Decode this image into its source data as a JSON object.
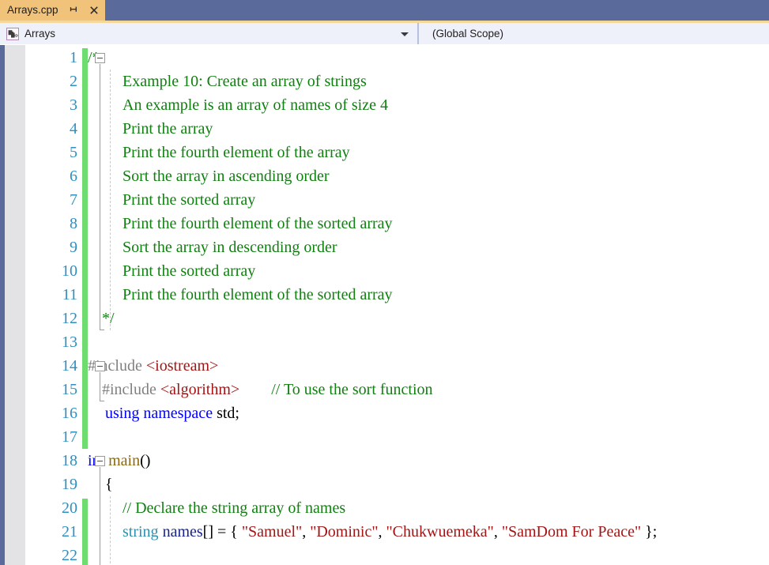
{
  "window": {
    "accent_tab_bg": "#f0c27a",
    "tabstrip_bg": "#5a6a9a",
    "navbar_bg": "#eef1fa",
    "changebar_color": "#6fdc6f"
  },
  "tab": {
    "title": "Arrays.cpp",
    "pin_icon": "pin-icon",
    "close_icon": "close-icon"
  },
  "navbar": {
    "project_icon": "cpp-project-icon",
    "scope_left": "Arrays",
    "scope_right": "(Global Scope)",
    "dropdown_icon": "chevron-down-icon"
  },
  "editor": {
    "language": "cpp",
    "first_line": 1,
    "last_visible_line": 22,
    "line_numbers": [
      1,
      2,
      3,
      4,
      5,
      6,
      7,
      8,
      9,
      10,
      11,
      12,
      13,
      14,
      15,
      16,
      17,
      18,
      19,
      20,
      21,
      22
    ],
    "lines": [
      {
        "n": 1,
        "indent": 0,
        "tokens": [
          {
            "t": "/*",
            "c": "comment"
          }
        ]
      },
      {
        "n": 2,
        "indent": 44,
        "tokens": [
          {
            "t": "Example 10: Create an array of strings",
            "c": "comment"
          }
        ]
      },
      {
        "n": 3,
        "indent": 44,
        "tokens": [
          {
            "t": "An example is an array of names of size 4",
            "c": "comment"
          }
        ]
      },
      {
        "n": 4,
        "indent": 44,
        "tokens": [
          {
            "t": "Print the array",
            "c": "comment"
          }
        ]
      },
      {
        "n": 5,
        "indent": 44,
        "tokens": [
          {
            "t": "Print the fourth element of the array",
            "c": "comment"
          }
        ]
      },
      {
        "n": 6,
        "indent": 44,
        "tokens": [
          {
            "t": "Sort the array in ascending order",
            "c": "comment"
          }
        ]
      },
      {
        "n": 7,
        "indent": 44,
        "tokens": [
          {
            "t": "Print the sorted array",
            "c": "comment"
          }
        ]
      },
      {
        "n": 8,
        "indent": 44,
        "tokens": [
          {
            "t": "Print the fourth element of the sorted array",
            "c": "comment"
          }
        ]
      },
      {
        "n": 9,
        "indent": 44,
        "tokens": [
          {
            "t": "Sort the array in descending order",
            "c": "comment"
          }
        ]
      },
      {
        "n": 10,
        "indent": 44,
        "tokens": [
          {
            "t": "Print the sorted array",
            "c": "comment"
          }
        ]
      },
      {
        "n": 11,
        "indent": 44,
        "tokens": [
          {
            "t": "Print the fourth element of the sorted array",
            "c": "comment"
          }
        ]
      },
      {
        "n": 12,
        "indent": 18,
        "tokens": [
          {
            "t": "*/",
            "c": "comment"
          }
        ]
      },
      {
        "n": 13,
        "indent": 0,
        "tokens": []
      },
      {
        "n": 14,
        "indent": 0,
        "tokens": [
          {
            "t": "#include ",
            "c": "preproc"
          },
          {
            "t": "<iostream>",
            "c": "header"
          }
        ]
      },
      {
        "n": 15,
        "indent": 18,
        "tokens": [
          {
            "t": "#include ",
            "c": "preproc"
          },
          {
            "t": "<algorithm>",
            "c": "header"
          },
          {
            "t": "        ",
            "c": "plain"
          },
          {
            "t": "// To use the sort function",
            "c": "comment"
          }
        ]
      },
      {
        "n": 16,
        "indent": 22,
        "tokens": [
          {
            "t": "using namespace ",
            "c": "keyword"
          },
          {
            "t": "std;",
            "c": "plain"
          }
        ]
      },
      {
        "n": 17,
        "indent": 0,
        "tokens": []
      },
      {
        "n": 18,
        "indent": 0,
        "tokens": [
          {
            "t": "int ",
            "c": "keyword"
          },
          {
            "t": "main",
            "c": "func"
          },
          {
            "t": "()",
            "c": "plain"
          }
        ]
      },
      {
        "n": 19,
        "indent": 22,
        "tokens": [
          {
            "t": "{",
            "c": "plain"
          }
        ]
      },
      {
        "n": 20,
        "indent": 44,
        "tokens": [
          {
            "t": "// Declare the string array of names",
            "c": "comment"
          }
        ]
      },
      {
        "n": 21,
        "indent": 44,
        "tokens": [
          {
            "t": "string ",
            "c": "class"
          },
          {
            "t": "names",
            "c": "var"
          },
          {
            "t": "[] = { ",
            "c": "plain"
          },
          {
            "t": "\"Samuel\"",
            "c": "string"
          },
          {
            "t": ", ",
            "c": "plain"
          },
          {
            "t": "\"Dominic\"",
            "c": "string"
          },
          {
            "t": ", ",
            "c": "plain"
          },
          {
            "t": "\"Chukwuemeka\"",
            "c": "string"
          },
          {
            "t": ", ",
            "c": "plain"
          },
          {
            "t": "\"SamDom For Peace\"",
            "c": "string"
          },
          {
            "t": " };",
            "c": "plain"
          }
        ]
      },
      {
        "n": 22,
        "indent": 0,
        "tokens": []
      }
    ],
    "fold_regions": [
      {
        "name": "block-comment-fold",
        "line": 1,
        "collapsed": false
      },
      {
        "name": "include-fold",
        "line": 14,
        "collapsed": false
      },
      {
        "name": "main-function-fold",
        "line": 18,
        "collapsed": false
      }
    ],
    "change_bar_segments": [
      {
        "from_line": 1,
        "to_line": 17
      },
      {
        "from_line": 20,
        "to_line": 22
      }
    ]
  }
}
